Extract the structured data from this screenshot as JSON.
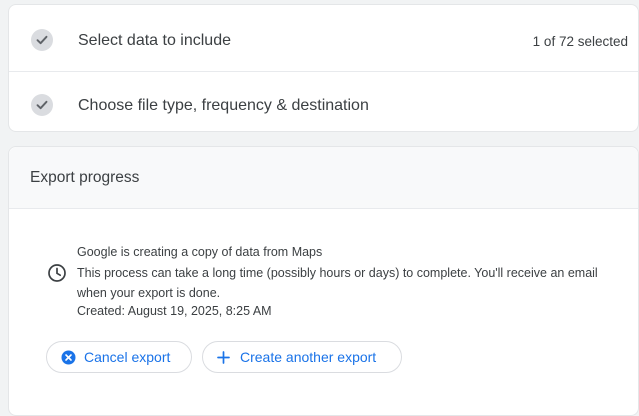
{
  "steps": {
    "step1": {
      "label": "Select data to include",
      "count": "1 of 72 selected"
    },
    "step2": {
      "label": "Choose file type, frequency & destination"
    }
  },
  "export": {
    "title": "Export progress",
    "message_title": "Google is creating a copy of data from Maps",
    "message_body": "This process can take a long time (possibly hours or days) to complete. You'll receive an email when your export is done.",
    "created": "Created: August 19, 2025, 8:25 AM",
    "cancel_label": "Cancel export",
    "create_label": "Create another export"
  },
  "colors": {
    "accent": "#1a73e8",
    "check_bg": "#dadce0",
    "text": "#3c4043"
  },
  "icons": {
    "check": "checkmark-icon",
    "clock": "clock-icon",
    "cancel": "cancel-circle-icon",
    "plus": "plus-icon"
  }
}
